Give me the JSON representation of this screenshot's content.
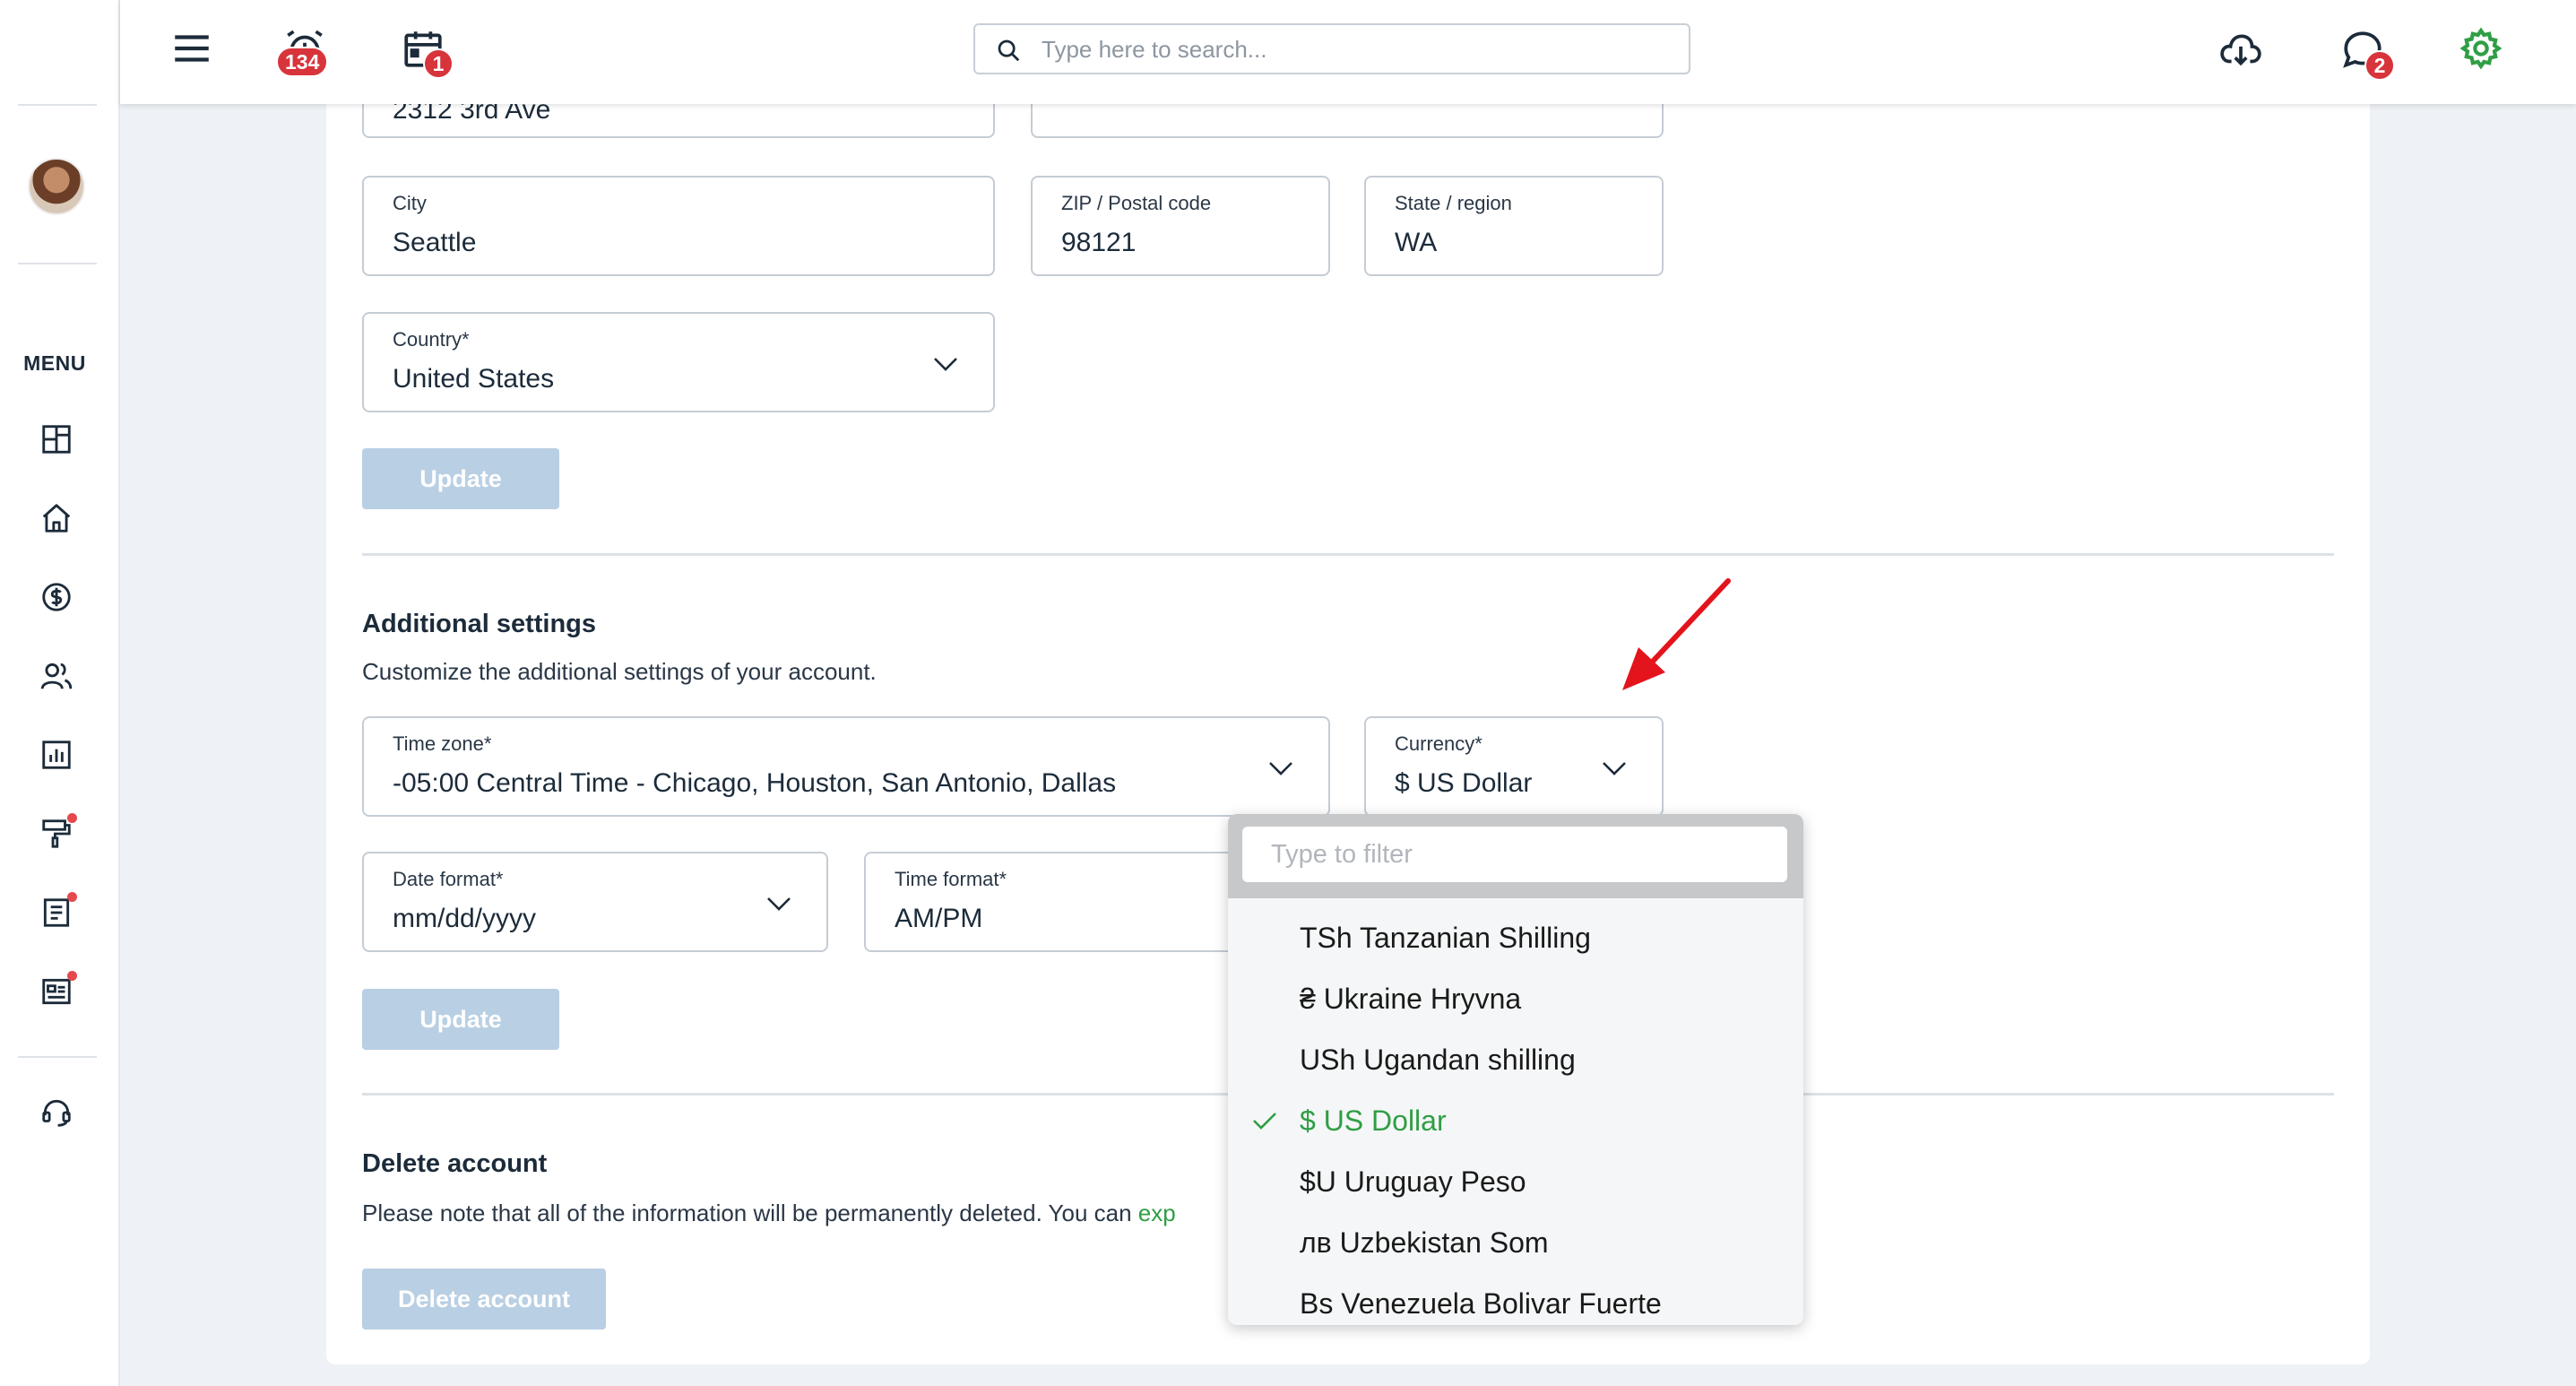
{
  "header": {
    "alarm_count": "134",
    "calendar_count": "1",
    "chat_count": "2",
    "search_placeholder": "Type here to search..."
  },
  "sidebar": {
    "menu_label": "MENU",
    "items": [
      {
        "icon": "dashboard-icon"
      },
      {
        "icon": "home-icon"
      },
      {
        "icon": "dollar-icon"
      },
      {
        "icon": "users-icon"
      },
      {
        "icon": "chart-icon"
      },
      {
        "icon": "paint-roller-icon",
        "dot": true
      },
      {
        "icon": "document-icon",
        "dot": true
      },
      {
        "icon": "newspaper-icon",
        "dot": true
      },
      {
        "icon": "support-headset-icon"
      }
    ]
  },
  "address": {
    "street_value": "2312 3rd Ave",
    "city_label": "City",
    "city_value": "Seattle",
    "zip_label": "ZIP / Postal code",
    "zip_value": "98121",
    "state_label": "State / region",
    "state_value": "WA",
    "country_label": "Country*",
    "country_value": "United States",
    "update_label": "Update"
  },
  "additional": {
    "title": "Additional settings",
    "description": "Customize the additional settings of your account.",
    "timezone_label": "Time zone*",
    "timezone_value": "-05:00 Central Time - Chicago, Houston, San Antonio, Dallas",
    "currency_label": "Currency*",
    "currency_value": "$ US Dollar",
    "date_format_label": "Date format*",
    "date_format_value": "mm/dd/yyyy",
    "time_format_label": "Time format*",
    "time_format_value": "AM/PM",
    "update_label": "Update"
  },
  "delete_account": {
    "title": "Delete account",
    "description": "Please note that all of the information will be permanently deleted. You can",
    "link_fragment": "exp",
    "button_label": "Delete account"
  },
  "currency_dropdown": {
    "filter_placeholder": "Type to filter",
    "options": [
      {
        "label": "TSh Tanzanian Shilling",
        "selected": false
      },
      {
        "label": "₴ Ukraine Hryvna",
        "selected": false
      },
      {
        "label": "USh Ugandan shilling",
        "selected": false
      },
      {
        "label": "$ US Dollar",
        "selected": true
      },
      {
        "label": "$U Uruguay Peso",
        "selected": false
      },
      {
        "label": "лв Uzbekistan Som",
        "selected": false
      },
      {
        "label": "Bs Venezuela Bolivar Fuerte",
        "selected": false
      }
    ]
  },
  "colors": {
    "accent_green": "#2f9e44",
    "badge_red": "#d8343b",
    "disabled_button": "#b9cfe3",
    "annotation_arrow": "#e3141c"
  }
}
